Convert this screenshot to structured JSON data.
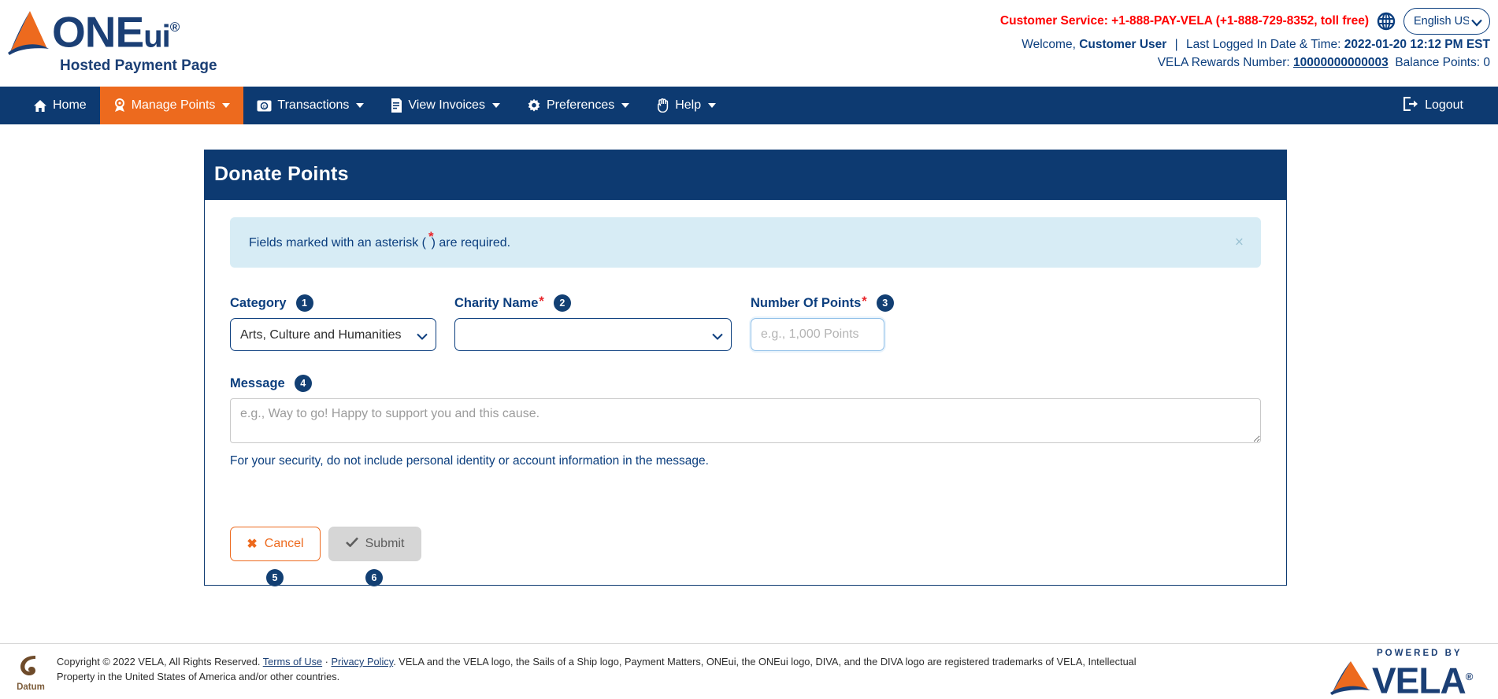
{
  "brand": {
    "logo_text": "ONE",
    "logo_text_sub": "ui",
    "logo_registered": "®",
    "tagline": "Hosted Payment Page",
    "accent_orange": "#ed6a1e",
    "navy": "#0d3a71",
    "alert_blue": "#d7ecf5",
    "required_red": "#e8252a"
  },
  "header": {
    "customer_service": "Customer Service: +1-888-PAY-VELA (+1-888-729-8352, toll free)",
    "globe_icon": "globe-icon",
    "language_selected": "English US",
    "language_options": [
      "English US"
    ],
    "welcome_prefix": "Welcome,",
    "user_name": "Customer User",
    "separator": "|",
    "last_login_label": "Last Logged In Date & Time:",
    "last_login_value": "2022-01-20 12:12 PM EST",
    "rewards_label": "VELA Rewards Number:",
    "rewards_number": "10000000000003",
    "balance_label": "Balance Points:",
    "balance_value": "0"
  },
  "nav": {
    "items": [
      {
        "label": "Home",
        "icon": "home-icon",
        "caret": false,
        "active": false
      },
      {
        "label": "Manage Points",
        "icon": "award-icon",
        "caret": true,
        "active": true
      },
      {
        "label": "Transactions",
        "icon": "transactions-icon",
        "caret": true,
        "active": false
      },
      {
        "label": "View Invoices",
        "icon": "invoice-icon",
        "caret": true,
        "active": false
      },
      {
        "label": "Preferences",
        "icon": "gear-icon",
        "caret": true,
        "active": false
      },
      {
        "label": "Help",
        "icon": "hand-icon",
        "caret": true,
        "active": false
      }
    ],
    "logout": {
      "label": "Logout",
      "icon": "logout-icon"
    }
  },
  "card": {
    "title": "Donate Points",
    "alert": {
      "text_before": "Fields marked with an asterisk (",
      "asterisk": "*",
      "text_after": ") are required.",
      "close_icon": "close-icon"
    },
    "fields": {
      "category": {
        "label": "Category",
        "badge": "1",
        "value": "Arts, Culture and Humanities",
        "options": [
          "Arts, Culture and Humanities"
        ],
        "required": false
      },
      "charity_name": {
        "label": "Charity Name",
        "required_mark": "*",
        "badge": "2",
        "value": "",
        "options": [
          ""
        ],
        "required": true
      },
      "number_of_points": {
        "label": "Number Of Points",
        "required_mark": "*",
        "badge": "3",
        "value": "",
        "placeholder": "e.g., 1,000 Points",
        "required": true,
        "focused": true
      },
      "message": {
        "label": "Message",
        "badge": "4",
        "value": "",
        "placeholder": "e.g., Way to go! Happy to support you and this cause.",
        "help": "For your security, do not include personal identity or account information in the message.",
        "required": false
      }
    },
    "buttons": {
      "cancel": {
        "label": "Cancel",
        "icon": "x-icon",
        "badge": "5"
      },
      "submit": {
        "label": "Submit",
        "icon": "check-icon",
        "badge": "6",
        "disabled": true
      }
    }
  },
  "footer": {
    "datum_label": "Datum",
    "copyright_part1": "Copyright © 2022 VELA, All Rights Reserved. ",
    "terms_link": "Terms of Use",
    "middot": " · ",
    "privacy_link": "Privacy Policy",
    "copyright_part2": ". VELA and the VELA logo, the Sails of a Ship logo, Payment Matters, ONEui, the ONEui logo, DIVA, and the DIVA logo are registered trademarks of VELA, Intellectual Property in the United States of America and/or other countries.",
    "powered_by": "POWERED BY",
    "vela_text": "VELA",
    "vela_registered": "®"
  }
}
